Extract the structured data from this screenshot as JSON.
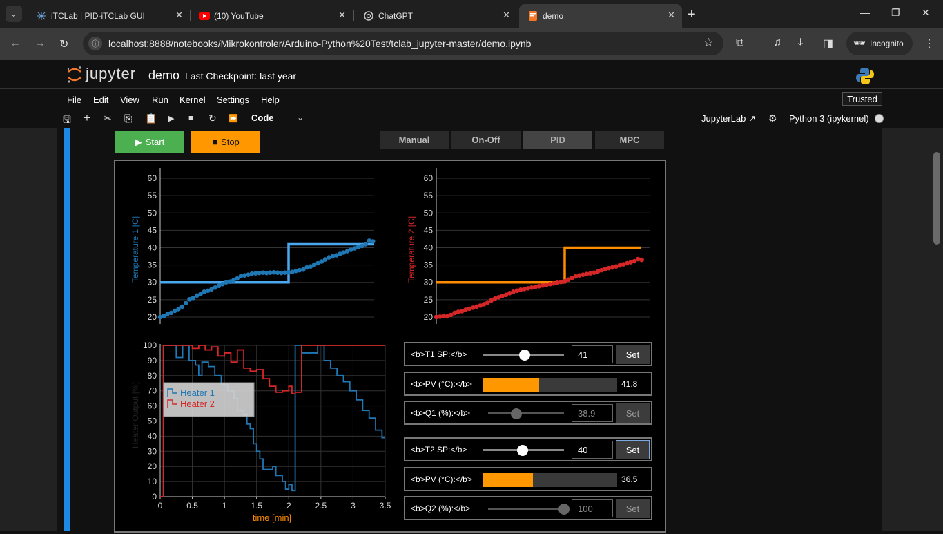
{
  "browser": {
    "tabs": [
      {
        "title": "iTCLab | PID-iTCLab GUI",
        "icon": "itclab-icon"
      },
      {
        "title": "(10) YouTube",
        "icon": "youtube-icon"
      },
      {
        "title": "ChatGPT",
        "icon": "chatgpt-icon"
      },
      {
        "title": "demo",
        "icon": "jupyter-notebook-icon"
      }
    ],
    "url": "localhost:8888/notebooks/Mikrokontroler/Arduino-Python%20Test/tclab_jupyter-master/demo.ipynb",
    "profile": "Incognito"
  },
  "jupyter": {
    "logo_text": "jupyter",
    "notebook_name": "demo",
    "checkpoint": "Last Checkpoint: last year",
    "menu": [
      "File",
      "Edit",
      "View",
      "Run",
      "Kernel",
      "Settings",
      "Help"
    ],
    "trusted": "Trusted",
    "cell_type": "Code",
    "jupyterlab_link": "JupyterLab",
    "kernel_name": "Python 3 (ipykernel)"
  },
  "app": {
    "start_label": "Start",
    "stop_label": "Stop",
    "modes": [
      "Manual",
      "On-Off",
      "PID",
      "MPC"
    ],
    "selected_mode": "PID",
    "controls": {
      "t1_sp": {
        "label": "<b>T1 SP:</b>",
        "value": "41",
        "set": "Set"
      },
      "pv1": {
        "label": "<b>PV (°C):</b>",
        "value": "41.8",
        "fill": 0.42
      },
      "q1": {
        "label": "<b>Q1 (%):</b>",
        "value": "38.9",
        "set": "Set"
      },
      "t2_sp": {
        "label": "<b>T2 SP:</b>",
        "value": "40",
        "set": "Set"
      },
      "pv2": {
        "label": "<b>PV (°C):</b>",
        "value": "36.5",
        "fill": 0.37
      },
      "q2": {
        "label": "<b>Q2 (%):</b>",
        "value": "100",
        "set": "Set"
      }
    }
  },
  "colors": {
    "t1": "#1f77b4",
    "t1_sp": "#4aa8f0",
    "t2": "#d62728",
    "t2_sp": "#ff8c00",
    "heater1": "#1f77b4",
    "heater2": "#d62728",
    "accent": "#1e88e5"
  },
  "chart_data": [
    {
      "type": "line",
      "ylabel": "Temperature 1 [C]",
      "ylim": [
        18,
        62
      ],
      "yticks": [
        "20",
        "25",
        "30",
        "35",
        "40",
        "45",
        "50",
        "55",
        "60"
      ],
      "series": [
        {
          "kind": "setpoint",
          "x": [
            0,
            2.1,
            2.1,
            3.5
          ],
          "y": [
            30,
            30,
            41,
            41
          ]
        },
        {
          "kind": "measured",
          "x": [
            0,
            0.06,
            0.12,
            0.18,
            0.24,
            0.3,
            0.36,
            0.42,
            0.48,
            0.54,
            0.6,
            0.66,
            0.72,
            0.78,
            0.84,
            0.9,
            0.96,
            1.02,
            1.08,
            1.14,
            1.2,
            1.26,
            1.32,
            1.38,
            1.44,
            1.5,
            1.56,
            1.62,
            1.68,
            1.74,
            1.8,
            1.86,
            1.92,
            1.98,
            2.04,
            2.1,
            2.16,
            2.22,
            2.28,
            2.34,
            2.4,
            2.46,
            2.52,
            2.58,
            2.64,
            2.7,
            2.76,
            2.82,
            2.88,
            2.94,
            3.0,
            3.06,
            3.12,
            3.18,
            3.24,
            3.3,
            3.36,
            3.42,
            3.48
          ],
          "y": [
            20.0,
            20.3,
            20.9,
            21.2,
            21.8,
            22.3,
            23.0,
            24.0,
            25.1,
            25.5,
            26.2,
            26.6,
            27.3,
            27.6,
            28.0,
            28.5,
            29.0,
            29.5,
            30.0,
            30.2,
            30.6,
            31.1,
            31.8,
            32.0,
            32.2,
            32.5,
            32.6,
            32.7,
            32.8,
            32.7,
            32.8,
            32.9,
            32.8,
            32.7,
            32.8,
            32.9,
            33.0,
            33.3,
            33.5,
            33.7,
            34.3,
            34.6,
            35.1,
            35.5,
            36.0,
            36.6,
            37.2,
            37.5,
            37.8,
            38.2,
            38.6,
            39.0,
            39.4,
            39.8,
            40.2,
            40.5,
            41.0,
            42.0,
            41.8
          ]
        }
      ]
    },
    {
      "type": "line",
      "ylabel": "Temperature 2 [C]",
      "ylim": [
        18,
        62
      ],
      "yticks": [
        "20",
        "25",
        "30",
        "35",
        "40",
        "45",
        "50",
        "55",
        "60"
      ],
      "series": [
        {
          "kind": "setpoint",
          "x": [
            0,
            2.1,
            2.1,
            3.35
          ],
          "y": [
            30,
            30,
            40,
            40
          ]
        },
        {
          "kind": "measured",
          "x": [
            0,
            0.06,
            0.12,
            0.18,
            0.24,
            0.3,
            0.36,
            0.42,
            0.48,
            0.54,
            0.6,
            0.66,
            0.72,
            0.78,
            0.84,
            0.9,
            0.96,
            1.02,
            1.08,
            1.14,
            1.2,
            1.26,
            1.32,
            1.38,
            1.44,
            1.5,
            1.56,
            1.62,
            1.68,
            1.74,
            1.8,
            1.86,
            1.92,
            1.98,
            2.04,
            2.1,
            2.16,
            2.22,
            2.28,
            2.34,
            2.4,
            2.46,
            2.52,
            2.58,
            2.64,
            2.7,
            2.76,
            2.82,
            2.88,
            2.94,
            3.0,
            3.06,
            3.12,
            3.18,
            3.24,
            3.3,
            3.36
          ],
          "y": [
            20.0,
            20.1,
            20.3,
            20.2,
            20.6,
            21.2,
            21.5,
            21.7,
            22.1,
            22.4,
            22.7,
            23.0,
            23.3,
            23.7,
            24.2,
            24.8,
            25.3,
            25.7,
            26.1,
            26.4,
            26.9,
            27.3,
            27.6,
            27.9,
            28.1,
            28.3,
            28.5,
            28.7,
            28.9,
            29.1,
            29.3,
            29.5,
            29.7,
            29.9,
            30.1,
            30.3,
            30.8,
            31.3,
            31.7,
            32.0,
            32.2,
            32.4,
            32.6,
            32.8,
            33.1,
            33.5,
            33.8,
            34.1,
            34.3,
            34.6,
            34.9,
            35.2,
            35.5,
            35.8,
            36.1,
            36.7,
            36.5
          ]
        }
      ]
    },
    {
      "type": "line",
      "xlabel": "time [min]",
      "ylabel": "Heater Output [%]",
      "xlim": [
        0,
        3.5
      ],
      "ylim": [
        0,
        100
      ],
      "xticks": [
        "0",
        "0.5",
        "1",
        "1.5",
        "2",
        "2.5",
        "3",
        "3.5"
      ],
      "yticks": [
        "0",
        "10",
        "20",
        "30",
        "40",
        "50",
        "60",
        "70",
        "80",
        "90",
        "100"
      ],
      "legend": "upper-left",
      "series": [
        {
          "name": "Heater 1",
          "x": [
            0,
            0.05,
            0.05,
            0.25,
            0.25,
            0.35,
            0.35,
            0.45,
            0.45,
            0.55,
            0.55,
            0.6,
            0.6,
            0.65,
            0.65,
            0.75,
            0.75,
            0.85,
            0.85,
            0.95,
            0.95,
            1.05,
            1.05,
            1.15,
            1.15,
            1.2,
            1.2,
            1.3,
            1.3,
            1.35,
            1.35,
            1.4,
            1.4,
            1.45,
            1.45,
            1.5,
            1.5,
            1.55,
            1.55,
            1.6,
            1.6,
            1.75,
            1.75,
            1.8,
            1.8,
            1.9,
            1.9,
            1.95,
            1.95,
            2.0,
            2.0,
            2.05,
            2.05,
            2.1,
            2.1,
            2.2,
            2.2,
            2.45,
            2.45,
            2.55,
            2.55,
            2.65,
            2.65,
            2.75,
            2.75,
            2.85,
            2.85,
            2.95,
            2.95,
            3.05,
            3.05,
            3.15,
            3.15,
            3.25,
            3.25,
            3.35,
            3.35,
            3.45,
            3.45,
            3.5
          ],
          "y": [
            0,
            0,
            100,
            100,
            92,
            92,
            100,
            100,
            90,
            90,
            87,
            87,
            80,
            80,
            89,
            89,
            86,
            86,
            80,
            80,
            74,
            74,
            70,
            70,
            65,
            65,
            57,
            57,
            54,
            54,
            48,
            48,
            45,
            45,
            35,
            35,
            30,
            30,
            25,
            25,
            18,
            18,
            20,
            20,
            14,
            14,
            10,
            10,
            5,
            5,
            8,
            8,
            4,
            4,
            100,
            100,
            95,
            95,
            100,
            100,
            90,
            90,
            85,
            85,
            80,
            80,
            76,
            76,
            70,
            70,
            64,
            64,
            57,
            57,
            52,
            52,
            44,
            44,
            39,
            39
          ]
        },
        {
          "name": "Heater 2",
          "x": [
            0,
            0.05,
            0.05,
            0.5,
            0.5,
            0.6,
            0.6,
            0.7,
            0.7,
            0.8,
            0.8,
            0.9,
            0.9,
            1.0,
            1.0,
            1.1,
            1.1,
            1.2,
            1.2,
            1.3,
            1.3,
            1.4,
            1.4,
            1.5,
            1.5,
            1.6,
            1.6,
            1.7,
            1.7,
            1.8,
            1.8,
            1.9,
            1.9,
            2.0,
            2.0,
            2.05,
            2.05,
            2.1,
            2.1,
            2.2,
            2.2,
            3.5
          ],
          "y": [
            0,
            0,
            100,
            100,
            98,
            98,
            100,
            100,
            97,
            97,
            99,
            99,
            93,
            93,
            95,
            95,
            89,
            89,
            97,
            97,
            85,
            85,
            83,
            83,
            84,
            84,
            78,
            78,
            73,
            73,
            69,
            69,
            70,
            70,
            73,
            73,
            68,
            68,
            69,
            69,
            100,
            100
          ]
        }
      ]
    }
  ]
}
